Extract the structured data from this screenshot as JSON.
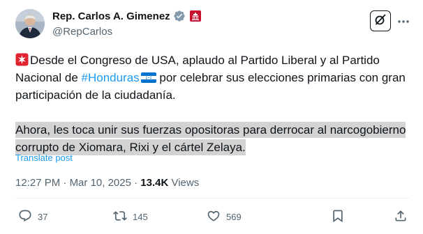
{
  "author": {
    "display_name": "Rep. Carlos A. Gimenez",
    "handle": "@RepCarlos"
  },
  "icons": {
    "verified": "verified-badge-icon",
    "affiliation": "capitol-affiliation-icon",
    "grok": "grok-icon",
    "more": "more-options-icon",
    "reply": "reply-icon",
    "retweet": "retweet-icon",
    "like": "like-icon",
    "bookmark": "bookmark-icon",
    "share": "share-icon"
  },
  "tweet": {
    "para1_pre": "Desde el Congreso de USA, aplaudo al Partido Liberal y al Partido Nacional de ",
    "hashtag": "#Honduras",
    "para1_post": " por celebrar sus elecciones primarias con gran participación de la ciudadanía.",
    "para2": "Ahora, les toca unir sus fuerzas opositoras para derrocar al narcogobierno corrupto de Xiomara, Rixi y el cártel Zelaya."
  },
  "translate_label": "Translate post",
  "meta": {
    "time": "12:27 PM",
    "separator": " · ",
    "date": "Mar 10, 2025",
    "views_count": "13.4K",
    "views_label": " Views"
  },
  "actions": {
    "replies": "37",
    "reposts": "145",
    "likes": "569"
  },
  "colors": {
    "accent": "#1d9bf0",
    "text": "#0f1419",
    "muted": "#536471",
    "highlight": "#d3d3d3"
  }
}
